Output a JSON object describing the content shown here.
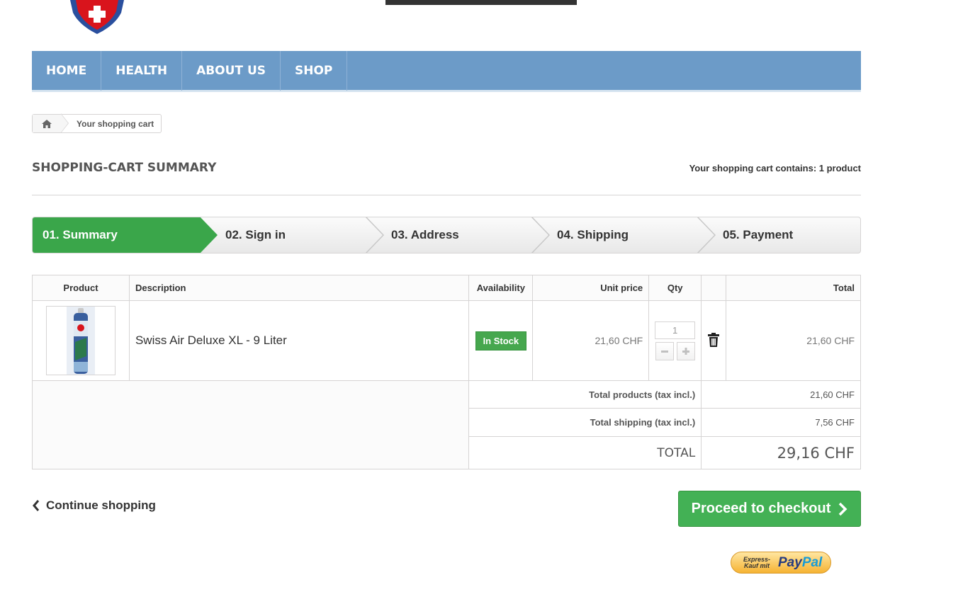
{
  "brand": {
    "logo_icon": "swiss-cross-shield"
  },
  "nav": {
    "items": [
      "HOME",
      "HEALTH",
      "ABOUT US",
      "SHOP"
    ]
  },
  "breadcrumb": {
    "home_icon": "home-icon",
    "current": "Your shopping cart"
  },
  "heading": {
    "title": "SHOPPING-CART SUMMARY",
    "count": "Your shopping cart contains: 1 product"
  },
  "steps": [
    {
      "label": "01. Summary",
      "active": true
    },
    {
      "label": "02. Sign in",
      "active": false
    },
    {
      "label": "03. Address",
      "active": false
    },
    {
      "label": "04. Shipping",
      "active": false
    },
    {
      "label": "05. Payment",
      "active": false
    }
  ],
  "table": {
    "headers": {
      "product": "Product",
      "description": "Description",
      "availability": "Availability",
      "unit_price": "Unit price",
      "qty": "Qty",
      "total": "Total"
    },
    "items": [
      {
        "description": "Swiss Air Deluxe XL - 9 Liter",
        "availability": "In Stock",
        "unit_price": "21,60 CHF",
        "qty": "1",
        "total": "21,60 CHF"
      }
    ],
    "summary": {
      "total_products_label": "Total products (tax incl.)",
      "total_products": "21,60 CHF",
      "total_shipping_label": "Total shipping (tax incl.)",
      "total_shipping": "7,56 CHF",
      "total_label": "TOTAL",
      "total": "29,16 CHF"
    }
  },
  "actions": {
    "continue": "Continue shopping",
    "checkout": "Proceed to checkout",
    "paypal_small": "Express-Kauf mit",
    "paypal_logo_a": "Pay",
    "paypal_logo_b": "Pal"
  },
  "colors": {
    "nav": "#6c9bc8",
    "active_step": "#3aa64a",
    "stock": "#46a74e",
    "checkout": "#43b155"
  }
}
